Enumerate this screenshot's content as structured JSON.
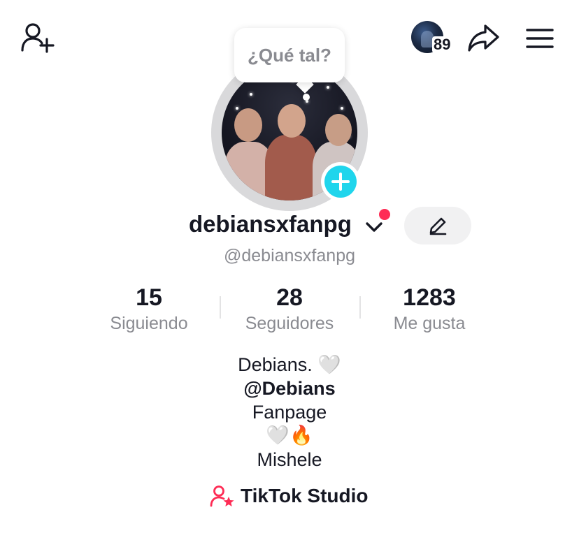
{
  "header": {
    "story_count": "89"
  },
  "bubble": {
    "text": "¿Qué tal?"
  },
  "profile": {
    "display_name": "debiansxfanpg",
    "handle": "@debiansxfanpg"
  },
  "stats": [
    {
      "value": "15",
      "label": "Siguiendo"
    },
    {
      "value": "28",
      "label": "Seguidores"
    },
    {
      "value": "1283",
      "label": "Me gusta"
    }
  ],
  "bio": {
    "line1": "Debians. 🤍",
    "line2": "@Debians",
    "line3": "Fanpage",
    "line4": "🤍🔥",
    "line5": "Mishele"
  },
  "studio": {
    "label": "TikTok Studio"
  },
  "colors": {
    "accent_pink": "#fe2c55",
    "plus_cyan": "#20d5ec",
    "text_primary": "#161823",
    "text_secondary": "#8a8b91"
  },
  "icons": [
    "add-friend-icon",
    "share-icon",
    "menu-icon",
    "chevron-down-icon",
    "edit-pencil-icon",
    "plus-icon",
    "studio-person-star-icon"
  ]
}
